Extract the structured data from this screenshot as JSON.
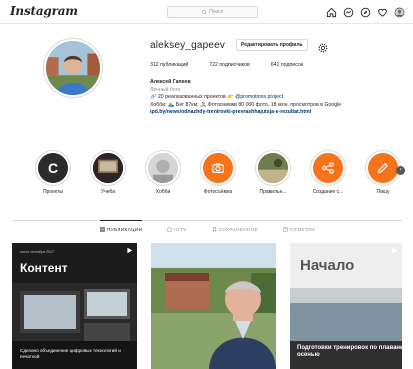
{
  "topbar": {
    "logo": "Instagram",
    "search_placeholder": "Поиск"
  },
  "profile": {
    "username": "aleksey_gapeev",
    "edit_button": "Редактировать профиль",
    "stats": {
      "posts": "312 публикаций",
      "followers": "722 подписчиков",
      "following": "641 подписок"
    },
    "bio": {
      "full_name": "Алексей Гапеев",
      "category": "Личный блог",
      "line1_prefix": "20 реализованных проектов",
      "line1_mention": "@promotions.project",
      "line2": "Хобби: 🏊 Бег 87км; 🚴 Фотоснимки 80 000 фото, 18 млн. просмотров в Google",
      "link": "ipd.by/news/odnazhdy-trenirovki-prevrashhajutsja-v-rezultat.html"
    }
  },
  "highlights": [
    {
      "label": "Проекты",
      "kind": "letter",
      "letter": "С",
      "bg": "#2b2b2b"
    },
    {
      "label": "Учеба",
      "kind": "photo",
      "bg": "#3a3030"
    },
    {
      "label": "Хобби",
      "kind": "photo",
      "bg": "#c9c9c9"
    },
    {
      "label": "Фотосъёмка",
      "kind": "camera-icon",
      "bg": "#f5731b"
    },
    {
      "label": "Правильн...",
      "kind": "photo",
      "bg": "#8a8a6a"
    },
    {
      "label": "Создание с...",
      "kind": "share-icon",
      "bg": "#f5731b"
    },
    {
      "label": "Пишу",
      "kind": "pencil-icon",
      "bg": "#f5731b"
    }
  ],
  "tabs": [
    {
      "label": "ПУБЛИКАЦИИ",
      "icon": "grid-icon",
      "active": true
    },
    {
      "label": "IGTV",
      "icon": "igtv-icon",
      "active": false
    },
    {
      "label": "СОХРАНЕННОЕ",
      "icon": "bookmark-icon",
      "active": false
    },
    {
      "label": "ОТМЕТКИ",
      "icon": "tag-icon",
      "active": false
    }
  ],
  "posts": [
    {
      "title": "Контент",
      "date": "пятое сентября 2017",
      "caption": "Сделано объединение цифровых технологий и печатной"
    },
    {
      "title": "",
      "caption": ""
    },
    {
      "title": "Начало",
      "caption": "Подготовки тренировок по плаванию осенью"
    }
  ],
  "colors": {
    "accent": "#f5731b",
    "link": "#00376b",
    "muted": "#8e8e8e",
    "border": "#dbdbdb"
  }
}
